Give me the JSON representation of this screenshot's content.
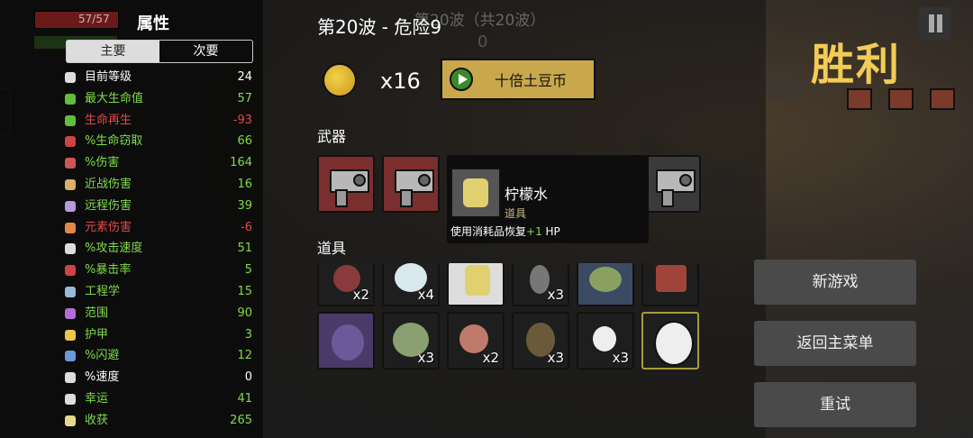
{
  "stats_panel": {
    "hp_text": "57/57",
    "title": "属性",
    "tabs": [
      "主要",
      "次要"
    ],
    "rows": [
      {
        "label": "目前等级",
        "value": "24",
        "color": "#ffffff",
        "icon": "level-icon",
        "icon_color": "#dddddd"
      },
      {
        "label": "最大生命值",
        "value": "57",
        "color": "#7fdc4a",
        "icon": "heart-icon",
        "icon_color": "#5fbf3a"
      },
      {
        "label": "生命再生",
        "value": "-93",
        "color": "#e04a4a",
        "icon": "regen-icon",
        "icon_color": "#5fbf3a"
      },
      {
        "label": "%生命窃取",
        "value": "66",
        "color": "#7fdc4a",
        "icon": "lifesteal-icon",
        "icon_color": "#cc4444"
      },
      {
        "label": "%伤害",
        "value": "164",
        "color": "#7fdc4a",
        "icon": "damage-icon",
        "icon_color": "#cc5555"
      },
      {
        "label": "近战伤害",
        "value": "16",
        "color": "#7fdc4a",
        "icon": "melee-icon",
        "icon_color": "#d8b06a"
      },
      {
        "label": "远程伤害",
        "value": "39",
        "color": "#7fdc4a",
        "icon": "ranged-icon",
        "icon_color": "#b89ad8"
      },
      {
        "label": "元素伤害",
        "value": "-6",
        "color": "#e04a4a",
        "icon": "elemental-icon",
        "icon_color": "#e08a4a"
      },
      {
        "label": "%攻击速度",
        "value": "51",
        "color": "#7fdc4a",
        "icon": "attack-speed-icon",
        "icon_color": "#dddddd"
      },
      {
        "label": "%暴击率",
        "value": "5",
        "color": "#7fdc4a",
        "icon": "crit-icon",
        "icon_color": "#cc4444"
      },
      {
        "label": "工程学",
        "value": "15",
        "color": "#7fdc4a",
        "icon": "engineering-icon",
        "icon_color": "#9ab8d8"
      },
      {
        "label": "范围",
        "value": "90",
        "color": "#7fdc4a",
        "icon": "range-icon",
        "icon_color": "#b86ad8"
      },
      {
        "label": "护甲",
        "value": "3",
        "color": "#7fdc4a",
        "icon": "armor-icon",
        "icon_color": "#e8c84a"
      },
      {
        "label": "%闪避",
        "value": "12",
        "color": "#7fdc4a",
        "icon": "dodge-icon",
        "icon_color": "#6a9ad8"
      },
      {
        "label": "%速度",
        "value": "0",
        "color": "#ffffff",
        "icon": "speed-icon",
        "icon_color": "#dddddd"
      },
      {
        "label": "幸运",
        "value": "41",
        "color": "#7fdc4a",
        "icon": "luck-icon",
        "icon_color": "#dddddd"
      },
      {
        "label": "收获",
        "value": "265",
        "color": "#7fdc4a",
        "icon": "harvest-icon",
        "icon_color": "#e8d88a"
      }
    ]
  },
  "header": {
    "wave_title": "第20波 - 危险9",
    "ghost_wave_text": "第20波（共20波）",
    "ghost_count": "0"
  },
  "currency": {
    "coin_count": "x16",
    "tenx_button_label": "十倍土豆币"
  },
  "sections": {
    "weapons_label": "武器",
    "items_label": "道具"
  },
  "tooltip": {
    "name": "柠檬水",
    "type": "道具",
    "desc_prefix": "使用消耗品恢复",
    "desc_bonus": "+1",
    "desc_suffix": " HP"
  },
  "items_row1_counts": [
    "x2",
    "x4",
    "",
    "x3",
    "",
    ""
  ],
  "items_row2_counts": [
    "",
    "x3",
    "x2",
    "x3",
    "x3",
    ""
  ],
  "victory": {
    "title": "胜利",
    "buttons": {
      "new_game": "新游戏",
      "main_menu": "返回主菜单",
      "retry": "重试"
    }
  }
}
